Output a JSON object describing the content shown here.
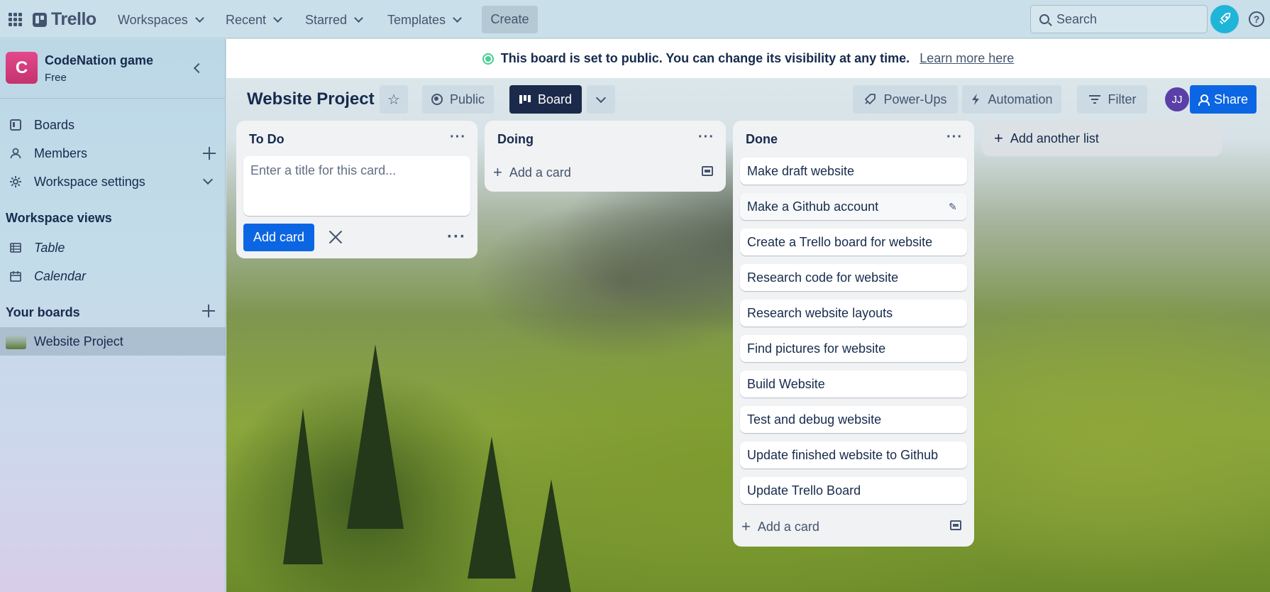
{
  "topbar": {
    "brand": "Trello",
    "nav": [
      "Workspaces",
      "Recent",
      "Starred",
      "Templates"
    ],
    "create": "Create",
    "search_placeholder": "Search",
    "help": "?"
  },
  "sidebar": {
    "workspace": {
      "initial": "C",
      "name": "CodeNation game",
      "plan": "Free"
    },
    "items": [
      {
        "label": "Boards"
      },
      {
        "label": "Members"
      },
      {
        "label": "Workspace settings"
      }
    ],
    "views_heading": "Workspace views",
    "views": [
      {
        "label": "Table"
      },
      {
        "label": "Calendar"
      }
    ],
    "boards_heading": "Your boards",
    "boards": [
      {
        "label": "Website Project"
      }
    ]
  },
  "notice": {
    "text": "This board is set to public. You can change its visibility at any time.",
    "link": "Learn more here"
  },
  "board": {
    "title": "Website Project",
    "visibility": "Public",
    "view": "Board",
    "power_ups": "Power-Ups",
    "automation": "Automation",
    "filter": "Filter",
    "member_initials": "JJ",
    "share": "Share"
  },
  "lists": [
    {
      "title": "To Do",
      "composer_placeholder": "Enter a title for this card...",
      "composer_submit": "Add card",
      "cards": []
    },
    {
      "title": "Doing",
      "add_card": "Add a card",
      "cards": []
    },
    {
      "title": "Done",
      "add_card": "Add a card",
      "cards": [
        "Make draft website",
        "Make a Github account",
        "Create a Trello board for website",
        "Research code for website",
        "Research website layouts",
        "Find pictures for website",
        "Build Website",
        "Test and debug website",
        "Update finished website to Github",
        "Update Trello Board"
      ]
    }
  ],
  "add_list": "Add another list",
  "colors": {
    "accent": "#0c66e4",
    "board_button": "#1b2a4a",
    "workspace_avatar": "#d63f7f",
    "notify": "#1fb5d8",
    "public_globe": "#4bce97"
  }
}
